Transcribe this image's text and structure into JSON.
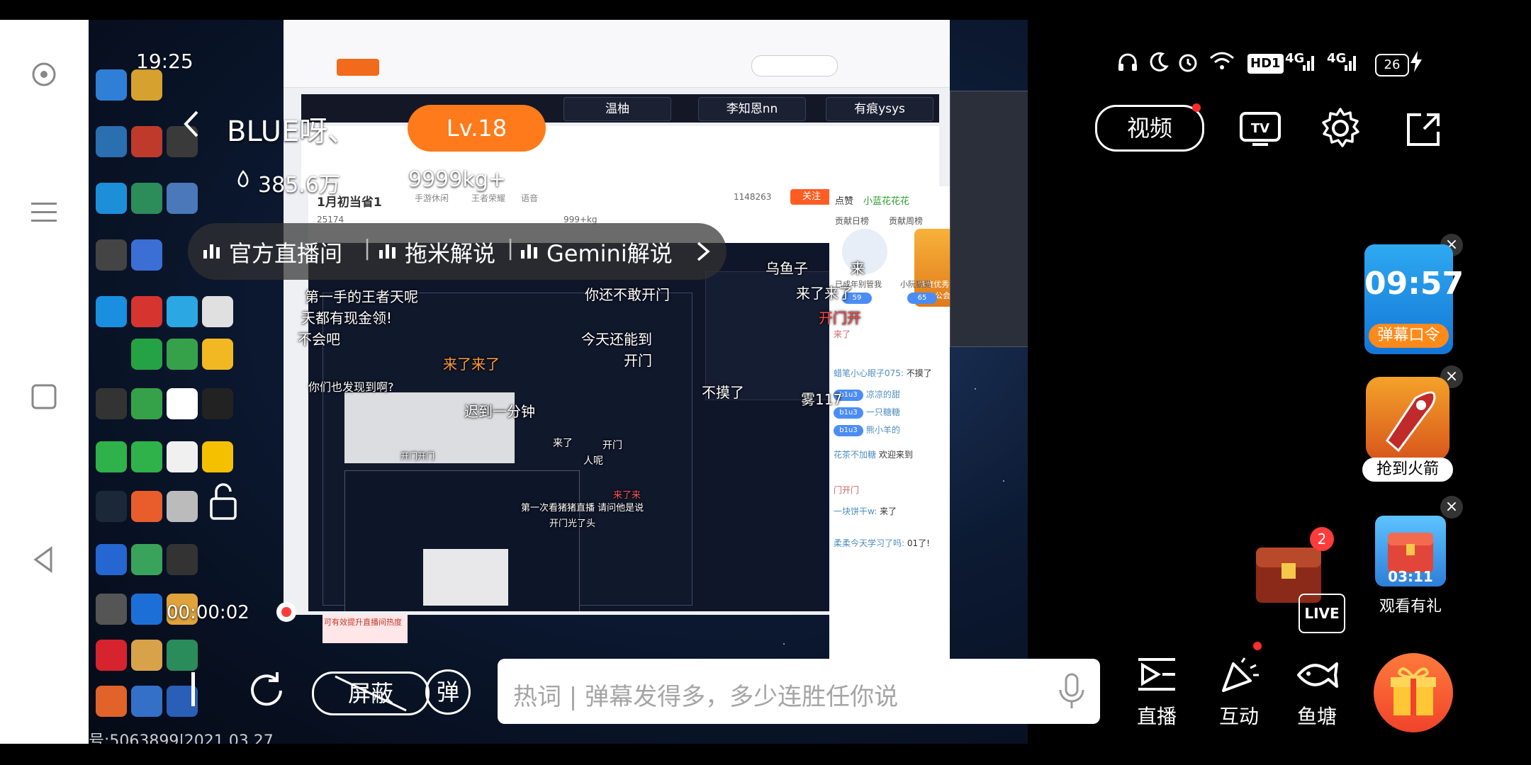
{
  "status_bar": {
    "time": "19:25",
    "battery": "26",
    "network_a": "4G",
    "network_b": "4G",
    "hd": "HD1"
  },
  "streamer": {
    "name": "BLUE呀、",
    "level": "Lv.18",
    "heat": "385.6万",
    "weight": "9999kg+"
  },
  "channels": {
    "official": "官方直播间",
    "tuomi": "拖米解说",
    "gemini": "Gemini解说"
  },
  "top_actions": {
    "video": "视频"
  },
  "widgets": {
    "countdown": {
      "time": "09:57",
      "label": "弹幕口令"
    },
    "rocket": {
      "label": "抢到火箭"
    },
    "chest": {
      "time": "03:11",
      "label": "观看有礼"
    },
    "treasure_badge": "2",
    "live_badge": "LIVE"
  },
  "recording": {
    "elapsed": "00:00:02"
  },
  "bottom_bar": {
    "block_label": "屏蔽",
    "danmu_label": "弹",
    "input_placeholder": "热词 | 弹幕发得多，多少连胜任你说",
    "nav_live": "直播",
    "nav_interact": "互动",
    "nav_pond": "鱼塘"
  },
  "stream_content": {
    "tabs": [
      "温柚",
      "李知恩nn",
      "有痕ysys"
    ],
    "room_title": "1月初当省1",
    "room_id": "1148263",
    "follow": "关注",
    "followers": "25174",
    "tags": [
      "手游休闲",
      "王者荣耀",
      "语音"
    ],
    "weight": "999+kg",
    "rank_label": "点赞",
    "rank_name": "小蓝花花花",
    "panel_tabs": [
      "贡献日榜",
      "贡献周榜"
    ],
    "guild": "李度优秀 星探公会",
    "top_fans": [
      "已成年别管我",
      "小阮猫猫"
    ],
    "panel_levels": [
      "59",
      "65"
    ],
    "chat": [
      {
        "user": "",
        "text": "来了"
      },
      {
        "user": "蜡笔小心眼子075:",
        "text": "不摸了"
      },
      {
        "user": "凉凉的甜",
        "text": ""
      },
      {
        "user": "一只糖糖",
        "text": ""
      },
      {
        "user": "熊小羊的",
        "text": ""
      },
      {
        "user": "花茶不加糖",
        "text": "欢迎来到"
      },
      {
        "user": "",
        "text": "门开门"
      },
      {
        "user": "一块饼干w:",
        "text": "来了"
      },
      {
        "user": "柔柔今天学习了吗:",
        "text": "01了!"
      }
    ],
    "watermark": "号:5063899|2021.03.27",
    "live_notice": "可有效提升直播间热度"
  },
  "danmaku": [
    "乌鱼子",
    "来",
    "来了来了",
    "开门开",
    "第一手的王者天呢",
    "你还不敢开门",
    "天都有现金领!",
    "不会吧",
    "今天还能到",
    "开门",
    "不摸了",
    "雾117",
    "来了来了",
    "你们也发现到啊?",
    "迟到一分钟",
    "开门开门",
    "来了",
    "开门",
    "人呢",
    "来了来",
    "第一次看猪猪直播 请问他是说",
    "开门光了头"
  ]
}
